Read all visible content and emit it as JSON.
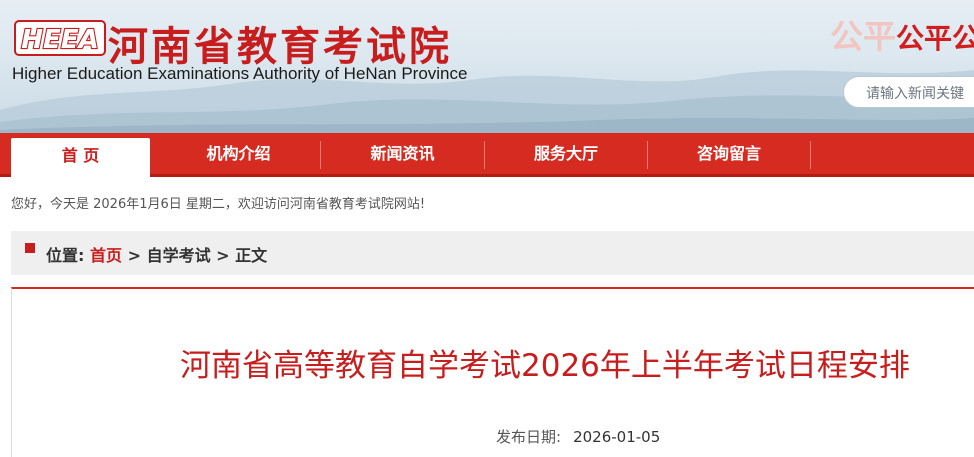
{
  "header": {
    "logo_text": "HEEA",
    "cn_title": "河南省教育考试院",
    "en_title": "Higher Education Examinations Authority of HeNan Province",
    "slogan_faded": "公平",
    "slogan_strong": "公平公",
    "search_placeholder": "请输入新闻关键",
    "colors": {
      "brand_red": "#c81d1d",
      "nav_red": "#d62b20"
    }
  },
  "nav": {
    "items": [
      {
        "label": "首 页",
        "active": true
      },
      {
        "label": "机构介绍"
      },
      {
        "label": "新闻资讯"
      },
      {
        "label": "服务大厅"
      },
      {
        "label": "咨询留言"
      }
    ]
  },
  "welcome": "您好，今天是 2026年1月6日 星期二，欢迎访问河南省教育考试院网站!",
  "breadcrumb": {
    "prefix": "位置:",
    "home": "首页",
    "sep1": ">",
    "section": "自学考试",
    "sep2": ">",
    "current": "正文"
  },
  "article": {
    "title": "河南省高等教育自学考试2026年上半年考试日程安排",
    "date_label": "发布日期:",
    "date_value": "2026-01-05"
  }
}
